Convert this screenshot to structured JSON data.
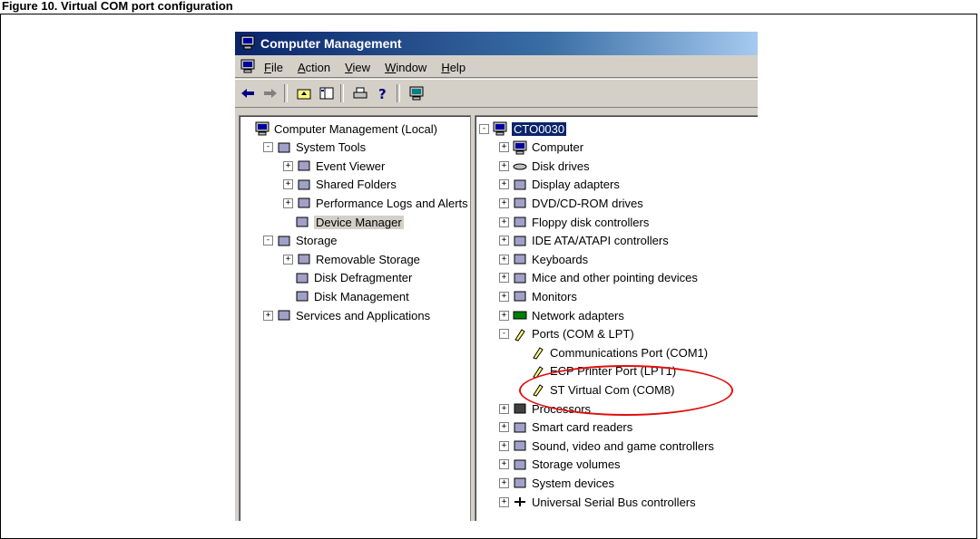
{
  "doc_heading": "Figure 10. Virtual COM port configuration",
  "window": {
    "title": "Computer Management",
    "menu": [
      "File",
      "Action",
      "View",
      "Window",
      "Help"
    ],
    "toolbar_icons": [
      "back-icon",
      "forward-icon",
      "up-folder-icon",
      "show-hide-tree-icon",
      "print-icon",
      "help-icon",
      "console-icon"
    ]
  },
  "left_tree": [
    {
      "label": "Computer Management (Local)",
      "icon": "computer-icon",
      "indent": 0,
      "exp": ""
    },
    {
      "label": "System Tools",
      "icon": "tools-icon",
      "indent": 1,
      "exp": "-"
    },
    {
      "label": "Event Viewer",
      "icon": "event-viewer-icon",
      "indent": 2,
      "exp": "+"
    },
    {
      "label": "Shared Folders",
      "icon": "shared-folder-icon",
      "indent": 2,
      "exp": "+"
    },
    {
      "label": "Performance Logs and Alerts",
      "icon": "performance-icon",
      "indent": 2,
      "exp": "+"
    },
    {
      "label": "Device Manager",
      "icon": "device-manager-icon",
      "indent": 2,
      "exp": "",
      "selected": true
    },
    {
      "label": "Storage",
      "icon": "storage-icon",
      "indent": 1,
      "exp": "-"
    },
    {
      "label": "Removable Storage",
      "icon": "removable-storage-icon",
      "indent": 2,
      "exp": "+"
    },
    {
      "label": "Disk Defragmenter",
      "icon": "defrag-icon",
      "indent": 2,
      "exp": ""
    },
    {
      "label": "Disk Management",
      "icon": "disk-management-icon",
      "indent": 2,
      "exp": ""
    },
    {
      "label": "Services and Applications",
      "icon": "services-icon",
      "indent": 1,
      "exp": "+"
    }
  ],
  "right_tree": [
    {
      "label": "CTO0030",
      "icon": "computer-icon",
      "indent": 0,
      "exp": "-",
      "selected": true
    },
    {
      "label": "Computer",
      "icon": "computer-icon",
      "indent": 1,
      "exp": "+"
    },
    {
      "label": "Disk drives",
      "icon": "disk-drive-icon",
      "indent": 1,
      "exp": "+"
    },
    {
      "label": "Display adapters",
      "icon": "display-adapter-icon",
      "indent": 1,
      "exp": "+"
    },
    {
      "label": "DVD/CD-ROM drives",
      "icon": "cdrom-icon",
      "indent": 1,
      "exp": "+"
    },
    {
      "label": "Floppy disk controllers",
      "icon": "floppy-icon",
      "indent": 1,
      "exp": "+"
    },
    {
      "label": "IDE ATA/ATAPI controllers",
      "icon": "ide-icon",
      "indent": 1,
      "exp": "+"
    },
    {
      "label": "Keyboards",
      "icon": "keyboard-icon",
      "indent": 1,
      "exp": "+"
    },
    {
      "label": "Mice and other pointing devices",
      "icon": "mouse-icon",
      "indent": 1,
      "exp": "+"
    },
    {
      "label": "Monitors",
      "icon": "monitor-icon",
      "indent": 1,
      "exp": "+"
    },
    {
      "label": "Network adapters",
      "icon": "network-icon",
      "indent": 1,
      "exp": "+"
    },
    {
      "label": "Ports (COM & LPT)",
      "icon": "port-icon",
      "indent": 1,
      "exp": "-"
    },
    {
      "label": "Communications Port (COM1)",
      "icon": "port-icon",
      "indent": 2,
      "exp": ""
    },
    {
      "label": "ECP Printer Port (LPT1)",
      "icon": "port-icon",
      "indent": 2,
      "exp": ""
    },
    {
      "label": "ST Virtual Com (COM8)",
      "icon": "port-icon",
      "indent": 2,
      "exp": "",
      "highlight": true
    },
    {
      "label": "Processors",
      "icon": "processor-icon",
      "indent": 1,
      "exp": "+"
    },
    {
      "label": "Smart card readers",
      "icon": "smartcard-icon",
      "indent": 1,
      "exp": "+"
    },
    {
      "label": "Sound, video and game controllers",
      "icon": "sound-icon",
      "indent": 1,
      "exp": "+"
    },
    {
      "label": "Storage volumes",
      "icon": "storage-volume-icon",
      "indent": 1,
      "exp": "+"
    },
    {
      "label": "System devices",
      "icon": "system-device-icon",
      "indent": 1,
      "exp": "+"
    },
    {
      "label": "Universal Serial Bus controllers",
      "icon": "usb-icon",
      "indent": 1,
      "exp": "+"
    }
  ],
  "colors": {
    "highlight_ellipse": "#e01010",
    "title_bar": "#0a246a",
    "selection": "#0a246a"
  }
}
